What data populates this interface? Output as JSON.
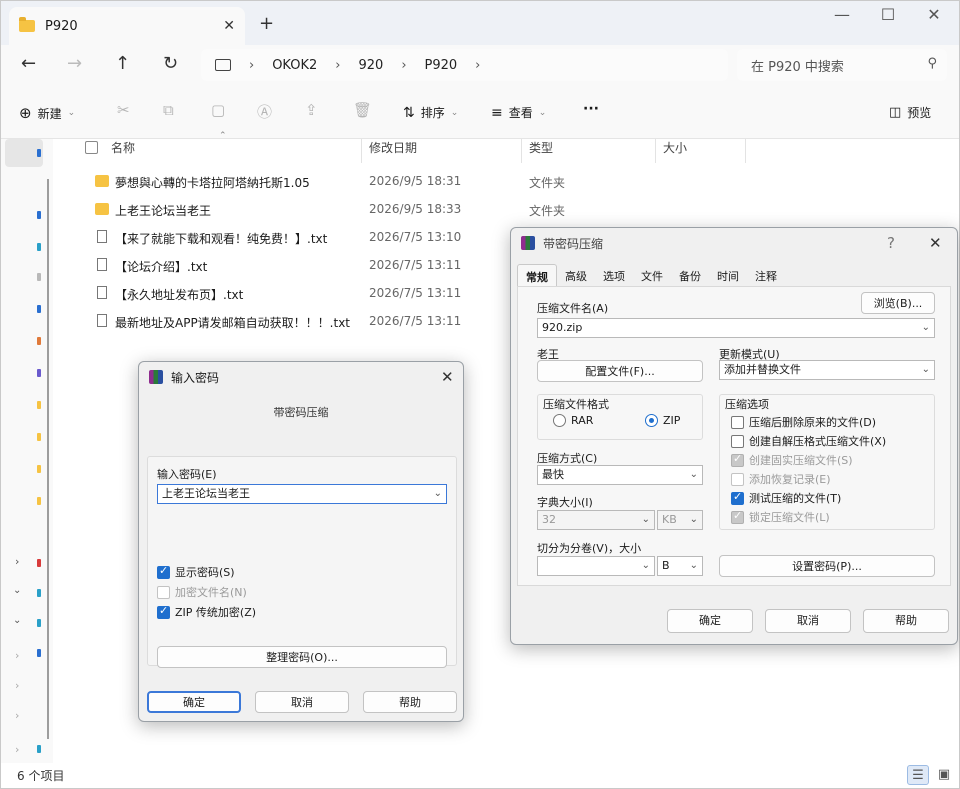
{
  "explorer": {
    "tab_title": "P920",
    "tab_close": "✕",
    "new_tab": "+",
    "window_controls": [
      "—",
      "☐",
      "✕"
    ],
    "nav": [
      "←",
      "→",
      "↑",
      "↻"
    ],
    "breadcrumb": [
      "OKOK2",
      "920",
      "P920"
    ],
    "search_placeholder": "在 P920 中搜索",
    "commands": {
      "new": "新建",
      "sort": "排序",
      "view": "查看",
      "more": "···",
      "preview": "预览"
    },
    "columns": {
      "name": "名称",
      "date": "修改日期",
      "type": "类型",
      "size": "大小"
    },
    "files": [
      {
        "name": "夢想與心轉的卡塔拉阿塔納托斯1.05",
        "date": "2026/9/5 18:31",
        "type": "文件夹",
        "kind": "folder"
      },
      {
        "name": "上老王论坛当老王",
        "date": "2026/9/5 18:33",
        "type": "文件夹",
        "kind": "folder"
      },
      {
        "name": "【来了就能下载和观看！纯免费！】.txt",
        "date": "2026/7/5 13:10",
        "type": "",
        "kind": "txt"
      },
      {
        "name": "【论坛介绍】.txt",
        "date": "2026/7/5 13:11",
        "type": "",
        "kind": "txt"
      },
      {
        "name": "【永久地址发布页】.txt",
        "date": "2026/7/5 13:11",
        "type": "",
        "kind": "txt"
      },
      {
        "name": "最新地址及APP请发邮箱自动获取！！！.txt",
        "date": "2026/7/5 13:11",
        "type": "",
        "kind": "txt"
      }
    ],
    "status": "6 个项目",
    "colors": {
      "folder": "#f6c343",
      "accent": "#1f6fce"
    }
  },
  "pwd_dialog": {
    "title": "输入密码",
    "subtitle": "带密码压缩",
    "field_label": "输入密码(E)",
    "field_value": "上老王论坛当老王",
    "checks": [
      {
        "label": "显示密码(S)",
        "checked": true,
        "enabled": true
      },
      {
        "label": "加密文件名(N)",
        "checked": false,
        "enabled": false
      },
      {
        "label": "ZIP 传统加密(Z)",
        "checked": true,
        "enabled": true
      }
    ],
    "organize_button": "整理密码(O)...",
    "ok": "确定",
    "cancel": "取消",
    "help": "帮助"
  },
  "rar_dialog": {
    "title": "带密码压缩",
    "help_glyph": "?",
    "tabs": [
      "常规",
      "高级",
      "选项",
      "文件",
      "备份",
      "时间",
      "注释"
    ],
    "archive_name_label": "压缩文件名(A)",
    "archive_name_value": "920.zip",
    "browse_button": "浏览(B)...",
    "profile_label": "老王",
    "profile_button": "配置文件(F)...",
    "update_label": "更新模式(U)",
    "update_value": "添加并替换文件",
    "format_label": "压缩文件格式",
    "format_rar": "RAR",
    "format_zip": "ZIP",
    "options_label": "压缩选项",
    "options": [
      {
        "label": "压缩后删除原来的文件(D)",
        "checked": false,
        "enabled": true
      },
      {
        "label": "创建自解压格式压缩文件(X)",
        "checked": false,
        "enabled": true
      },
      {
        "label": "创建固实压缩文件(S)",
        "checked": true,
        "enabled": false
      },
      {
        "label": "添加恢复记录(E)",
        "checked": false,
        "enabled": false
      },
      {
        "label": "测试压缩的文件(T)",
        "checked": true,
        "enabled": true
      },
      {
        "label": "锁定压缩文件(L)",
        "checked": true,
        "enabled": false
      }
    ],
    "method_label": "压缩方式(C)",
    "method_value": "最快",
    "dict_label": "字典大小(I)",
    "dict_value": "32",
    "dict_unit": "KB",
    "split_label": "切分为分卷(V)，大小",
    "split_value": "",
    "split_unit": "B",
    "set_password_button": "设置密码(P)...",
    "ok": "确定",
    "cancel": "取消",
    "help": "帮助"
  }
}
